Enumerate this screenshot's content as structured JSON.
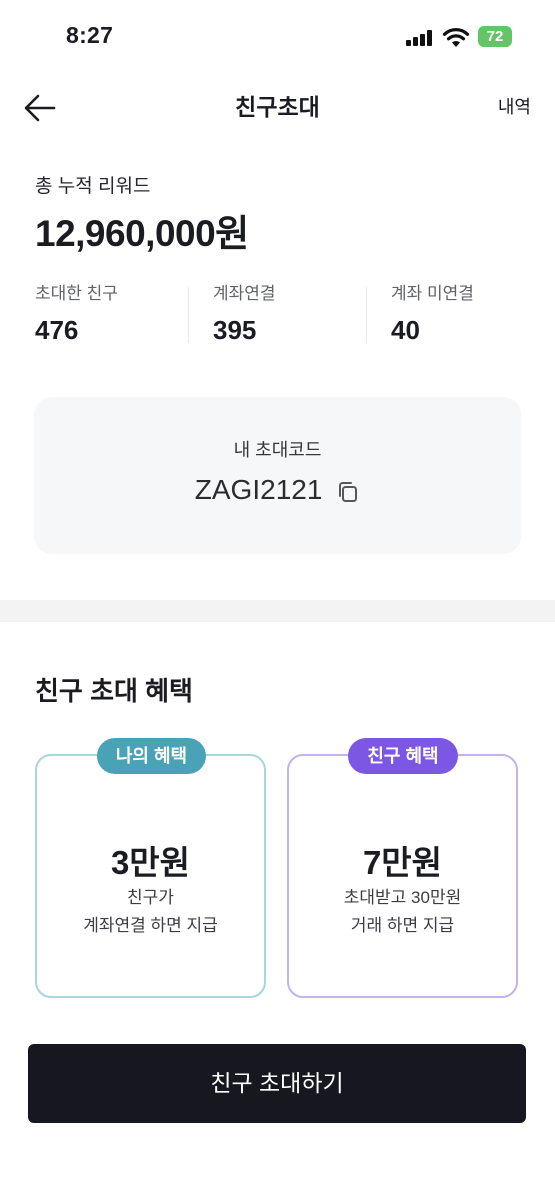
{
  "status_bar": {
    "time": "8:27",
    "battery": "72"
  },
  "header": {
    "title": "친구초대",
    "history_label": "내역"
  },
  "summary": {
    "total_label": "총 누적 리워드",
    "total_value": "12,960,000원",
    "stats": [
      {
        "label": "초대한 친구",
        "value": "476"
      },
      {
        "label": "계좌연결",
        "value": "395"
      },
      {
        "label": "계좌 미연결",
        "value": "40"
      }
    ]
  },
  "invite_code": {
    "label": "내 초대코드",
    "code": "ZAGI2121"
  },
  "benefits": {
    "title": "친구 초대 혜택",
    "mine": {
      "badge": "나의 혜택",
      "amount": "3만원",
      "desc_line1": "친구가",
      "desc_line2": "계좌연결 하면 지급",
      "color": "#4aa2b7"
    },
    "friend": {
      "badge": "친구 혜택",
      "amount": "7만원",
      "desc_line1": "초대받고 30만원",
      "desc_line2": "거래 하면 지급",
      "color": "#7b57e4"
    }
  },
  "cta": {
    "label": "친구 초대하기"
  }
}
